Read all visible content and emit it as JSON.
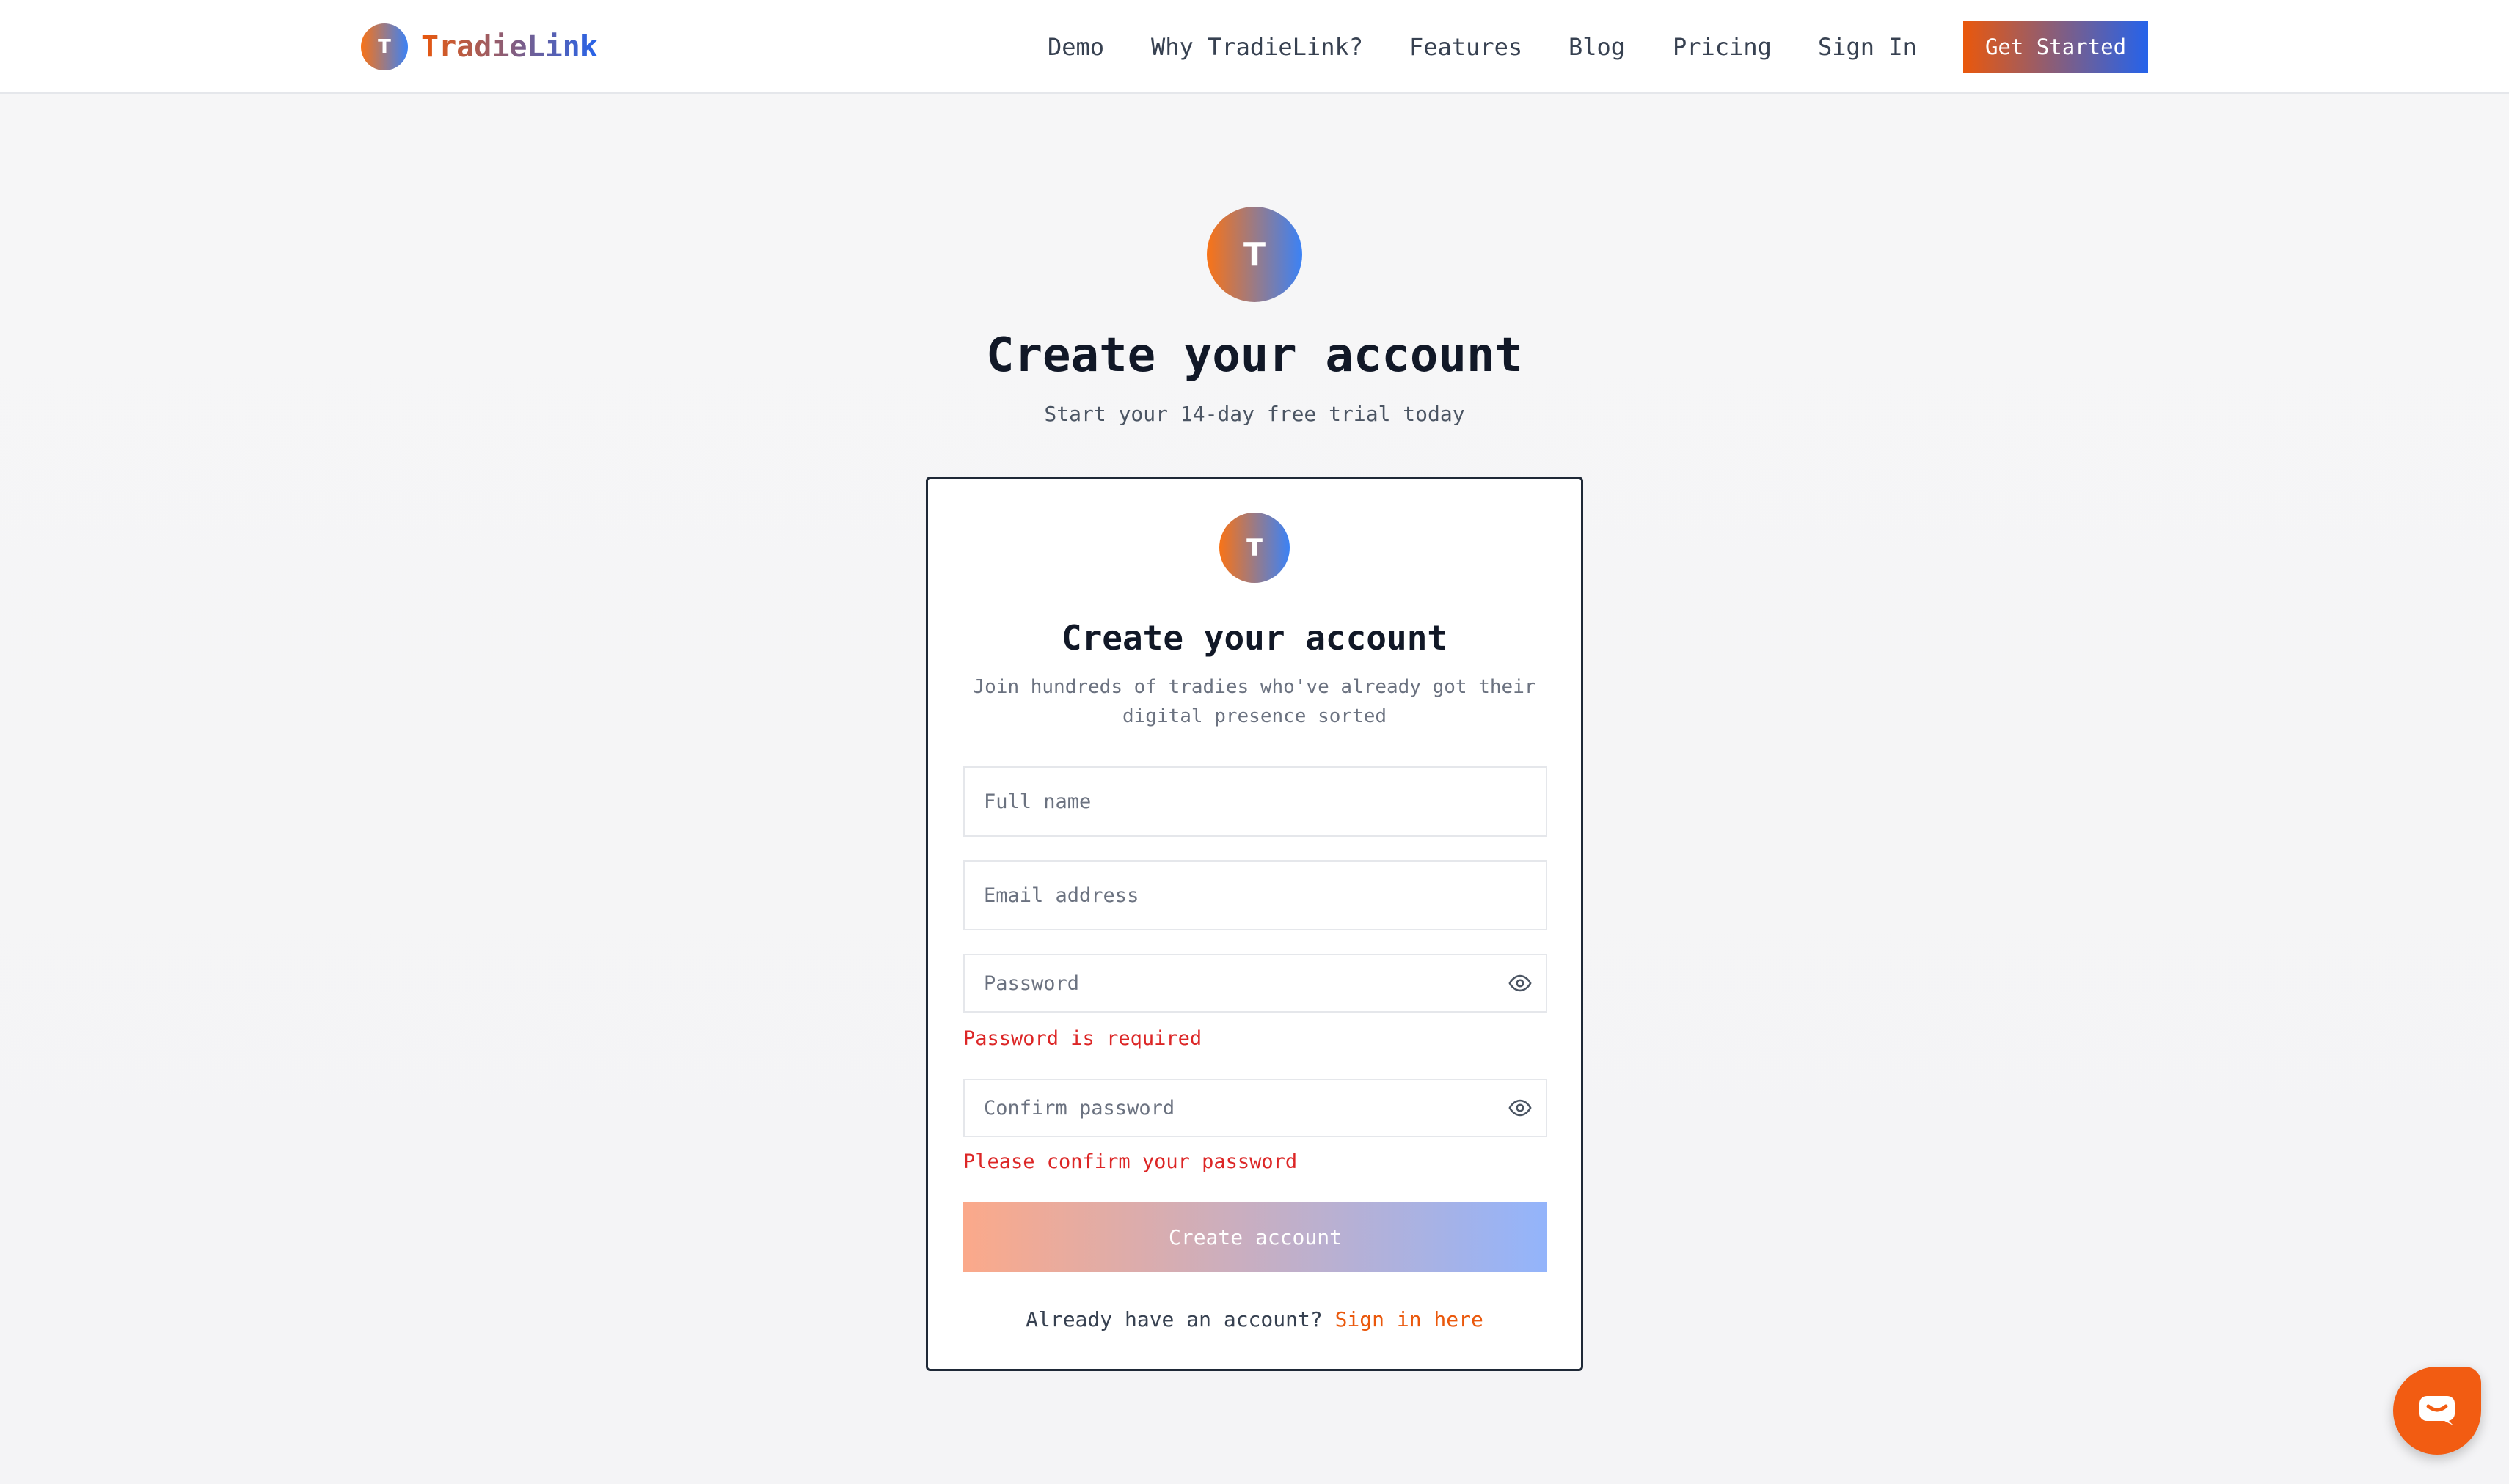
{
  "header": {
    "brand_initial": "T",
    "brand_name": "TradieLink",
    "nav": [
      {
        "label": "Demo"
      },
      {
        "label": "Why TradieLink?"
      },
      {
        "label": "Features"
      },
      {
        "label": "Blog"
      },
      {
        "label": "Pricing"
      },
      {
        "label": "Sign In"
      }
    ],
    "cta_label": "Get Started"
  },
  "hero": {
    "logo_initial": "T",
    "title": "Create your account",
    "subtitle": "Start your 14-day free trial today"
  },
  "card": {
    "logo_initial": "T",
    "title": "Create your account",
    "subtitle": "Join hundreds of tradies who've already got their digital presence sorted",
    "fields": {
      "full_name": {
        "value": "",
        "placeholder": "Full name"
      },
      "email": {
        "value": "",
        "placeholder": "Email address"
      },
      "password": {
        "value": "",
        "placeholder": "Password",
        "error": "Password is required"
      },
      "confirm_password": {
        "value": "",
        "placeholder": "Confirm password",
        "error": "Please confirm your password"
      }
    },
    "submit_label": "Create account",
    "signin_prompt": "Already have an account?",
    "signin_link": "Sign in here"
  },
  "icons": {
    "password_toggle": "eye-icon",
    "confirm_toggle": "eye-icon",
    "chat": "chat-icon"
  },
  "colors": {
    "accent_orange": "#ea580c",
    "accent_blue": "#2563eb",
    "error_red": "#dc2626",
    "chat_orange": "#f25c12"
  }
}
